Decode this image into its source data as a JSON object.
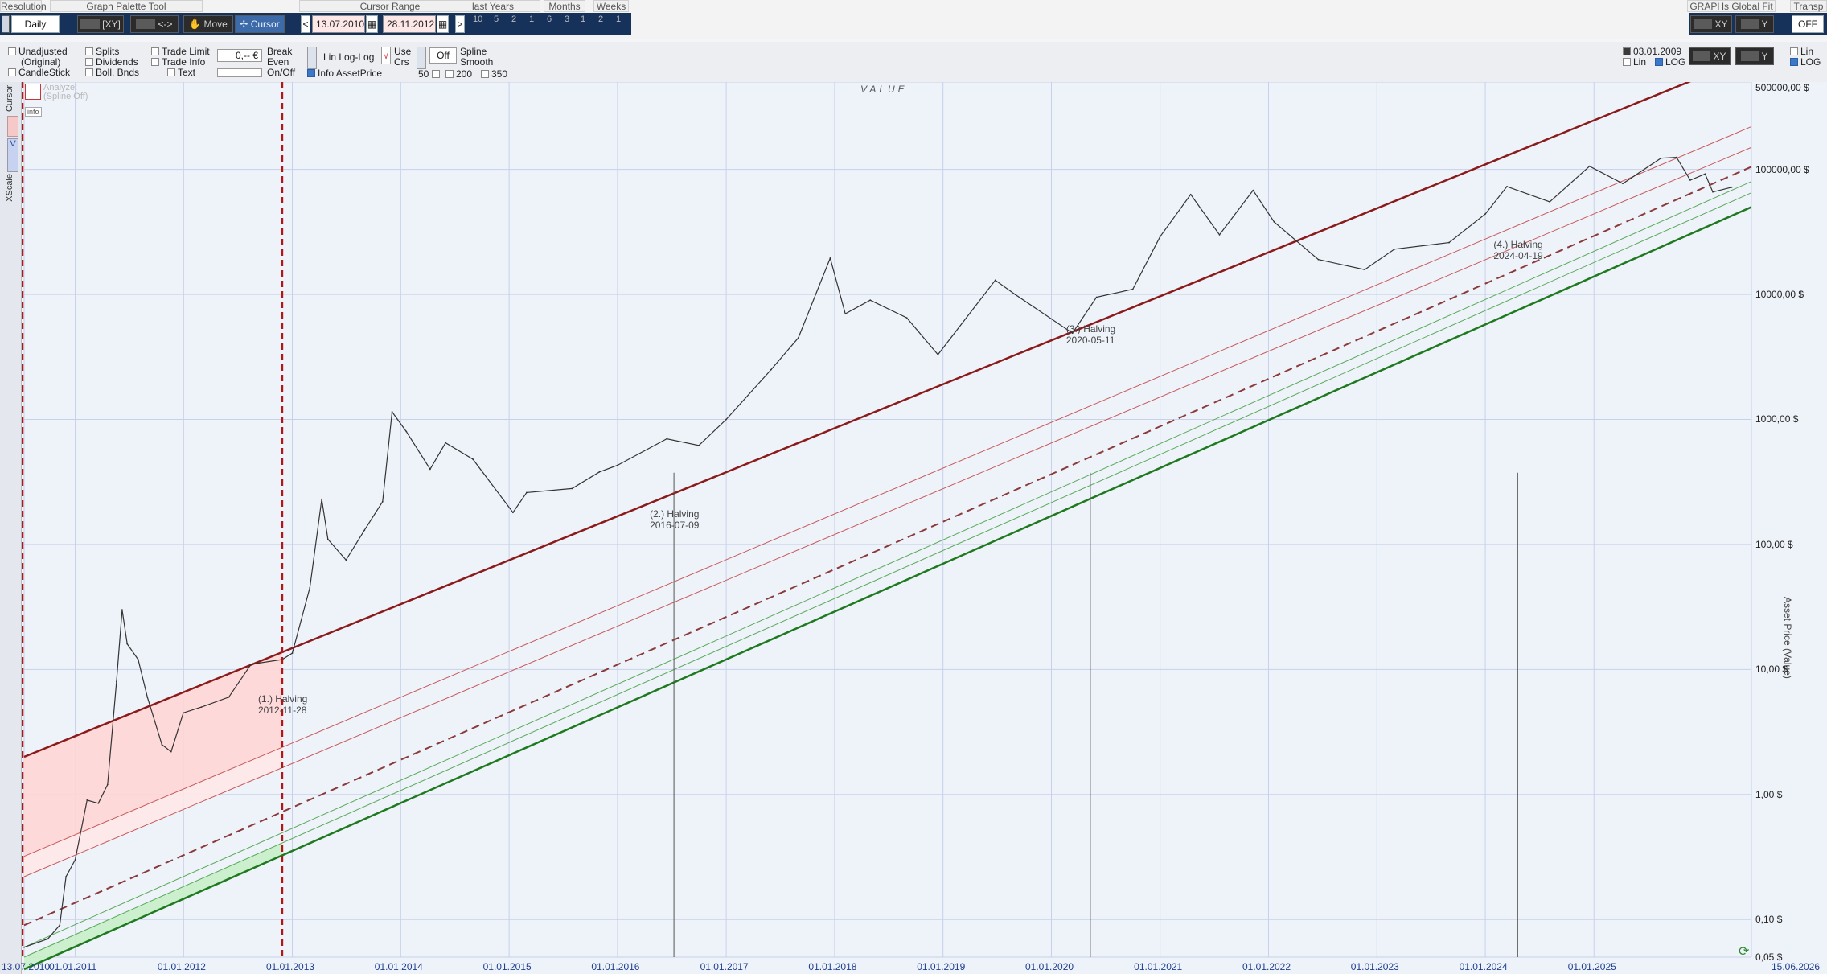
{
  "toolbar": {
    "groups": {
      "resolution": "Resolution",
      "palette": "Graph Palette Tool",
      "cursor_range": "Cursor Range",
      "last_years": "last Years",
      "months": "Months",
      "weeks": "Weeks",
      "global_fit": "GRAPHs Global Fit",
      "transp": "Transp"
    },
    "resolution_value": "Daily",
    "xy_label": "[XY]",
    "arrows_label": "<->",
    "move_label": "Move",
    "cursor_label": "Cursor",
    "range_prev": "<",
    "range_start": "13.07.2010",
    "range_end": "28.11.2012",
    "range_next": ">",
    "last_years": [
      "10",
      "5",
      "2",
      "1"
    ],
    "months": [
      "6",
      "3",
      "1"
    ],
    "weeks": [
      "2",
      "1"
    ],
    "fit_xy": "XY",
    "fit_y": "Y",
    "transp_value": "OFF"
  },
  "options": {
    "unadjusted": "Unadjusted",
    "original": "(Original)",
    "candlestick": "CandleStick",
    "splits": "Splits",
    "dividends": "Dividends",
    "boll": "Boll. Bnds",
    "trade_limit": "Trade Limit",
    "trade_info": "Trade Info",
    "text": "Text",
    "price_value": "0,-- €",
    "break_even": "Break",
    "even": "Even",
    "onoff": "On/Off",
    "linlog": "Lin Log-Log",
    "use": "Use",
    "crs": "Crs",
    "info_asset": "Info AssetPrice",
    "off": "Off",
    "spline": "Spline",
    "smooth": "Smooth",
    "spline_opts": [
      "50",
      "200",
      "350"
    ],
    "right_date": "03.01.2009",
    "right_lin": "Lin",
    "right_log": "LOG",
    "right_xy": "XY",
    "right_y": "Y",
    "far_lin": "Lin",
    "far_log": "LOG"
  },
  "side": {
    "cursor": "Cursor",
    "xscale": "XScale",
    "v": "V",
    "analyze": "Analyze:",
    "spline_off": "(Spline Off)",
    "info": "info"
  },
  "chart_data": {
    "type": "line",
    "title": "VALUE",
    "ylabel": "Asset Price (Value)",
    "yscale": "log",
    "ylim": [
      0.05,
      500000
    ],
    "x_ticks": [
      "13.07.2010",
      "01.01.2011",
      "01.01.2012",
      "01.01.2013",
      "01.01.2014",
      "01.01.2015",
      "01.01.2016",
      "01.01.2017",
      "01.01.2018",
      "01.01.2019",
      "01.01.2020",
      "01.01.2021",
      "01.01.2022",
      "01.01.2023",
      "01.01.2024",
      "01.01.2025",
      "15.06.2026"
    ],
    "y_ticks": [
      "500000,00 $",
      "100000,00 $",
      "10000,00 $",
      "1000,00 $",
      "100,00 $",
      "10,00 $",
      "1,00 $",
      "0,10 $",
      "0,05 $"
    ],
    "halvings": [
      {
        "label": "(1.) Halving",
        "date": "2012-11-28"
      },
      {
        "label": "(2.) Halving",
        "date": "2016-07-09"
      },
      {
        "label": "(3.) Halving",
        "date": "2020-05-11"
      },
      {
        "label": "(4.) Halving",
        "date": "2024-04-19"
      }
    ],
    "series": [
      {
        "name": "Asset Price",
        "points": [
          [
            "2010-07-13",
            0.06
          ],
          [
            "2010-10-01",
            0.07
          ],
          [
            "2010-11-10",
            0.09
          ],
          [
            "2010-12-01",
            0.22
          ],
          [
            "2011-01-01",
            0.3
          ],
          [
            "2011-02-10",
            0.9
          ],
          [
            "2011-03-20",
            0.85
          ],
          [
            "2011-04-20",
            1.2
          ],
          [
            "2011-05-20",
            8.0
          ],
          [
            "2011-06-08",
            30.0
          ],
          [
            "2011-06-25",
            16.0
          ],
          [
            "2011-08-01",
            12.0
          ],
          [
            "2011-09-01",
            6.0
          ],
          [
            "2011-10-20",
            2.5
          ],
          [
            "2011-11-20",
            2.2
          ],
          [
            "2011-12-31",
            4.5
          ],
          [
            "2012-03-01",
            5.0
          ],
          [
            "2012-06-01",
            6.0
          ],
          [
            "2012-08-15",
            11.0
          ],
          [
            "2012-11-28",
            12.0
          ],
          [
            "2013-01-01",
            13.5
          ],
          [
            "2013-03-01",
            45.0
          ],
          [
            "2013-04-10",
            230.0
          ],
          [
            "2013-05-01",
            110.0
          ],
          [
            "2013-07-01",
            75.0
          ],
          [
            "2013-09-01",
            130.0
          ],
          [
            "2013-11-01",
            220.0
          ],
          [
            "2013-12-03",
            1150.0
          ],
          [
            "2014-01-20",
            800.0
          ],
          [
            "2014-04-10",
            400.0
          ],
          [
            "2014-06-01",
            650.0
          ],
          [
            "2014-09-01",
            480.0
          ],
          [
            "2015-01-14",
            180.0
          ],
          [
            "2015-03-01",
            260.0
          ],
          [
            "2015-08-01",
            280.0
          ],
          [
            "2015-11-01",
            380.0
          ],
          [
            "2016-01-01",
            430.0
          ],
          [
            "2016-06-15",
            700.0
          ],
          [
            "2016-10-01",
            620.0
          ],
          [
            "2017-01-01",
            1000.0
          ],
          [
            "2017-06-01",
            2500.0
          ],
          [
            "2017-09-01",
            4500.0
          ],
          [
            "2017-12-17",
            19500.0
          ],
          [
            "2018-02-06",
            7000.0
          ],
          [
            "2018-05-01",
            9000.0
          ],
          [
            "2018-09-01",
            6500.0
          ],
          [
            "2018-12-15",
            3300.0
          ],
          [
            "2019-06-26",
            13000.0
          ],
          [
            "2019-09-01",
            10000.0
          ],
          [
            "2020-03-12",
            4900.0
          ],
          [
            "2020-06-01",
            9500.0
          ],
          [
            "2020-10-01",
            11000.0
          ],
          [
            "2021-01-01",
            29000.0
          ],
          [
            "2021-04-14",
            63000.0
          ],
          [
            "2021-07-20",
            30000.0
          ],
          [
            "2021-11-10",
            68000.0
          ],
          [
            "2022-01-20",
            38000.0
          ],
          [
            "2022-06-18",
            19000.0
          ],
          [
            "2022-11-21",
            15800.0
          ],
          [
            "2023-03-01",
            23000.0
          ],
          [
            "2023-09-01",
            26000.0
          ],
          [
            "2024-01-01",
            44000.0
          ],
          [
            "2024-03-14",
            73000.0
          ],
          [
            "2024-08-05",
            55000.0
          ],
          [
            "2024-12-17",
            106000.0
          ],
          [
            "2025-04-08",
            77000.0
          ],
          [
            "2025-08-14",
            123000.0
          ],
          [
            "2025-10-06",
            125000.0
          ],
          [
            "2025-11-21",
            82000.0
          ],
          [
            "2026-01-10",
            92000.0
          ],
          [
            "2026-02-05",
            66000.0
          ],
          [
            "2026-04-10",
            72000.0
          ]
        ]
      }
    ],
    "colors": {
      "upper_band": "#8b1a1a",
      "lower_band": "#1f7a1f",
      "mid_dashed": "#8a3a3a",
      "red_fill": "#ffd6d6",
      "green_fill": "#c8f0c8",
      "price": "#333333",
      "cursor_line": "#b01818",
      "grid": "#c7d1ea"
    }
  }
}
